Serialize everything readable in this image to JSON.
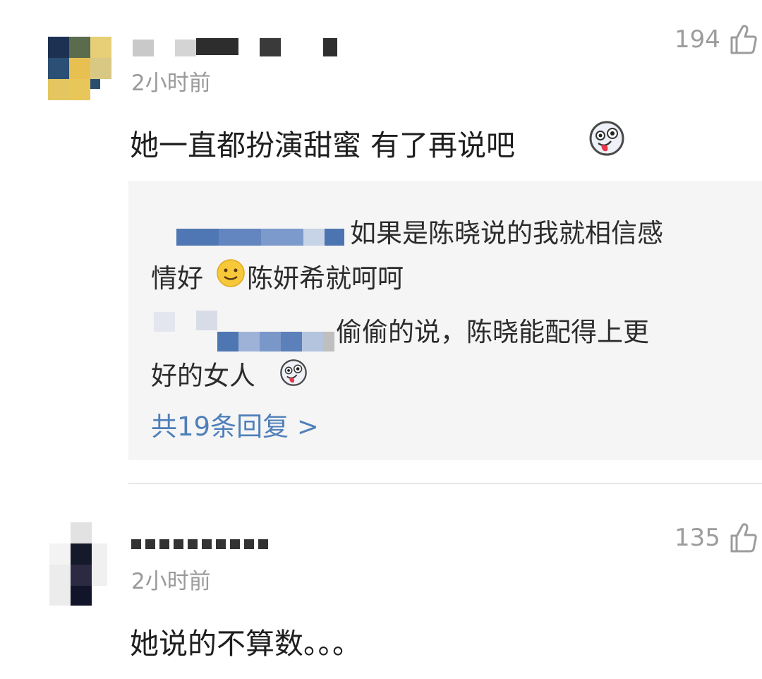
{
  "comments": [
    {
      "time": "2小时前",
      "likes": "194",
      "text": "她一直都扮演甜蜜 有了再说吧",
      "replies": [
        {
          "line1": "如果是陈晓说的我就相信感",
          "line2a": "情好",
          "line2b": "陈妍希就呵呵"
        },
        {
          "line1": "偷偷的说，陈晓能配得上更",
          "line2": "好的女人"
        }
      ],
      "more_replies": "共19条回复 >"
    },
    {
      "time": "2小时前",
      "likes": "135",
      "text": "她说的不算数。。。"
    }
  ],
  "icons": {
    "like": "thumbs-up-outline-icon",
    "emoji_tongue": "tongue-out-emoji-icon",
    "emoji_smile": "smile-emoji-icon"
  },
  "colors": {
    "link": "#4f7fb9",
    "reply_bg": "#f5f5f5",
    "meta_gray": "#9a9a9a"
  }
}
